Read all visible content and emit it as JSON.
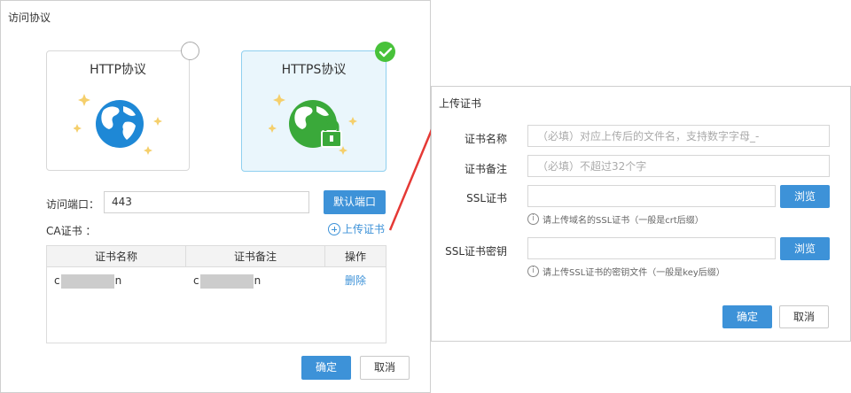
{
  "left_dialog": {
    "title": "访问协议",
    "protocols": [
      {
        "name": "HTTP协议",
        "selected": false
      },
      {
        "name": "HTTPS协议",
        "selected": true
      }
    ],
    "port_label": "访问端口：",
    "port_value": "443",
    "default_port_button": "默认端口",
    "ca_label": "CA证书  ：",
    "upload_link": "上传证书",
    "table": {
      "headers": [
        "证书名称",
        "证书备注",
        "操作"
      ],
      "rows": [
        {
          "name_prefix": "c",
          "name_suffix": "n",
          "note_prefix": "c",
          "note_suffix": "n",
          "action": "删除"
        }
      ]
    },
    "confirm_button": "确定",
    "cancel_button": "取消"
  },
  "right_dialog": {
    "title": "上传证书",
    "cert_name_label": "证书名称",
    "cert_name_placeholder": "（必填）对应上传后的文件名，支持数字字母_-",
    "cert_note_label": "证书备注",
    "cert_note_placeholder": "（必填）不超过32个字",
    "ssl_cert_label": "SSL证书",
    "ssl_cert_browse": "浏览",
    "ssl_cert_hint": "请上传域名的SSL证书（一般是crt后缀）",
    "ssl_key_label": "SSL证书密钥",
    "ssl_key_browse": "浏览",
    "ssl_key_hint": "请上传SSL证书的密钥文件（一般是key后缀）",
    "confirm_button": "确定",
    "cancel_button": "取消"
  },
  "colors": {
    "primary": "#3d92d8",
    "selected_check": "#48c23a",
    "arrow": "#e53935"
  }
}
